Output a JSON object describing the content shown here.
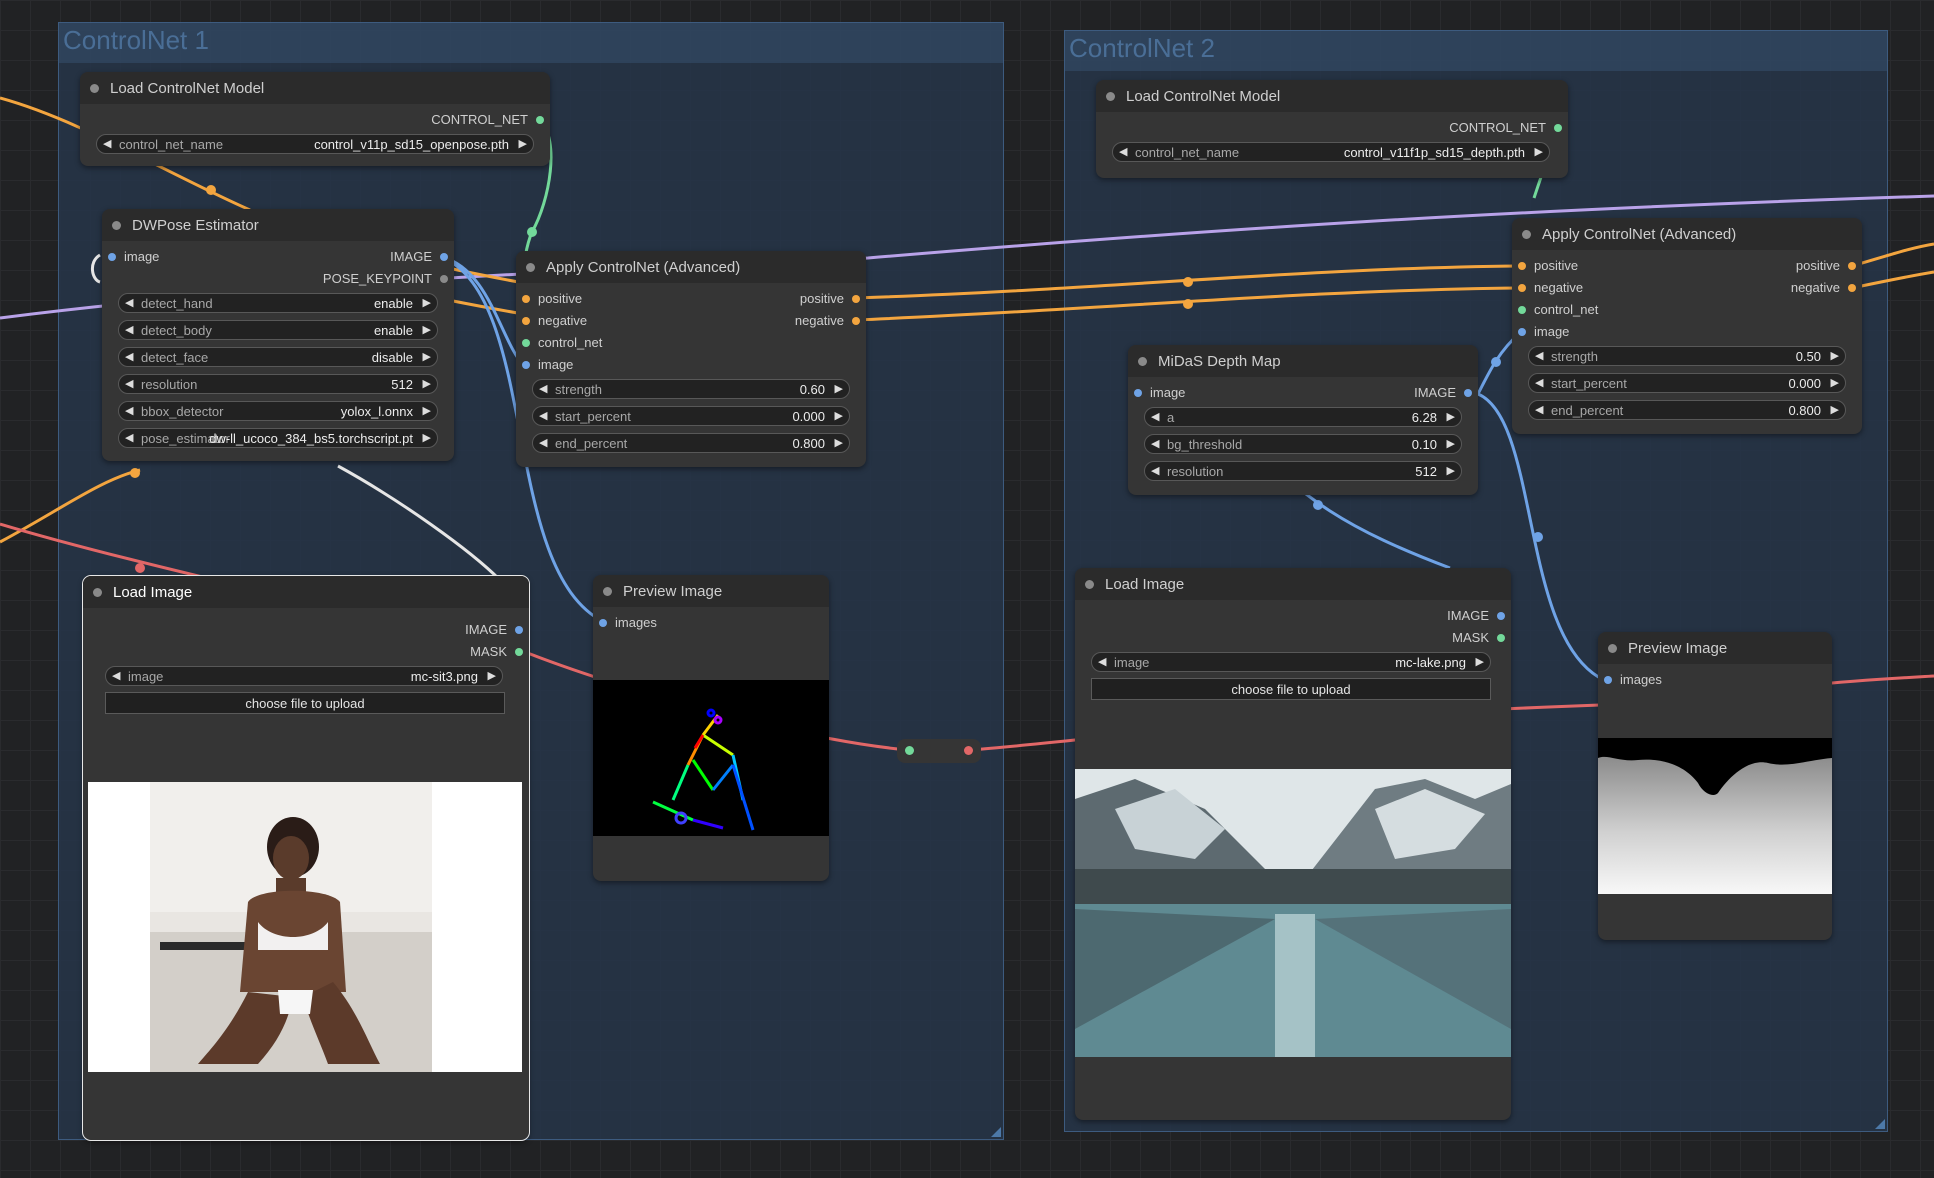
{
  "colors": {
    "accent_image_wire": "#6fa3e6",
    "conditioning_wire": "#f3a53f",
    "controlnet_wire": "#73d99a",
    "model_wire": "#b9a2e9",
    "vae_wire": "#e26767",
    "pose_wire": "#e6e6e6",
    "group_fill": "#26364a"
  },
  "groups": [
    {
      "title": "ControlNet 1"
    },
    {
      "title": "ControlNet 2"
    }
  ],
  "nodes": {
    "cn1_loader": {
      "title": "Load ControlNet Model",
      "output": "CONTROL_NET",
      "widget": {
        "label": "control_net_name",
        "value": "control_v11p_sd15_openpose.pth"
      }
    },
    "dwpose": {
      "title": "DWPose Estimator",
      "input": "image",
      "outputs": [
        "IMAGE",
        "POSE_KEYPOINT"
      ],
      "widgets": [
        {
          "label": "detect_hand",
          "value": "enable"
        },
        {
          "label": "detect_body",
          "value": "enable"
        },
        {
          "label": "detect_face",
          "value": "disable"
        },
        {
          "label": "resolution",
          "value": "512"
        },
        {
          "label": "bbox_detector",
          "value": "yolox_l.onnx"
        },
        {
          "label": "pose_estimator",
          "value": "dw-ll_ucoco_384_bs5.torchscript.pt"
        }
      ]
    },
    "apply1": {
      "title": "Apply ControlNet (Advanced)",
      "inputs": [
        "positive",
        "negative",
        "control_net",
        "image"
      ],
      "outputs": [
        "positive",
        "negative"
      ],
      "widgets": [
        {
          "label": "strength",
          "value": "0.60"
        },
        {
          "label": "start_percent",
          "value": "0.000"
        },
        {
          "label": "end_percent",
          "value": "0.800"
        }
      ]
    },
    "load1": {
      "title": "Load Image",
      "outputs": [
        "IMAGE",
        "MASK"
      ],
      "widget": {
        "label": "image",
        "value": "mc-sit3.png"
      },
      "button": "choose file to upload"
    },
    "preview1": {
      "title": "Preview Image",
      "input": "images"
    },
    "cn2_loader": {
      "title": "Load ControlNet Model",
      "output": "CONTROL_NET",
      "widget": {
        "label": "control_net_name",
        "value": "control_v11f1p_sd15_depth.pth"
      }
    },
    "apply2": {
      "title": "Apply ControlNet (Advanced)",
      "inputs": [
        "positive",
        "negative",
        "control_net",
        "image"
      ],
      "outputs": [
        "positive",
        "negative"
      ],
      "widgets": [
        {
          "label": "strength",
          "value": "0.50"
        },
        {
          "label": "start_percent",
          "value": "0.000"
        },
        {
          "label": "end_percent",
          "value": "0.800"
        }
      ]
    },
    "midas": {
      "title": "MiDaS Depth Map",
      "input": "image",
      "output": "IMAGE",
      "widgets": [
        {
          "label": "a",
          "value": "6.28"
        },
        {
          "label": "bg_threshold",
          "value": "0.10"
        },
        {
          "label": "resolution",
          "value": "512"
        }
      ]
    },
    "load2": {
      "title": "Load Image",
      "outputs": [
        "IMAGE",
        "MASK"
      ],
      "widget": {
        "label": "image",
        "value": "mc-lake.png"
      },
      "button": "choose file to upload"
    },
    "preview2": {
      "title": "Preview Image",
      "input": "images"
    }
  }
}
